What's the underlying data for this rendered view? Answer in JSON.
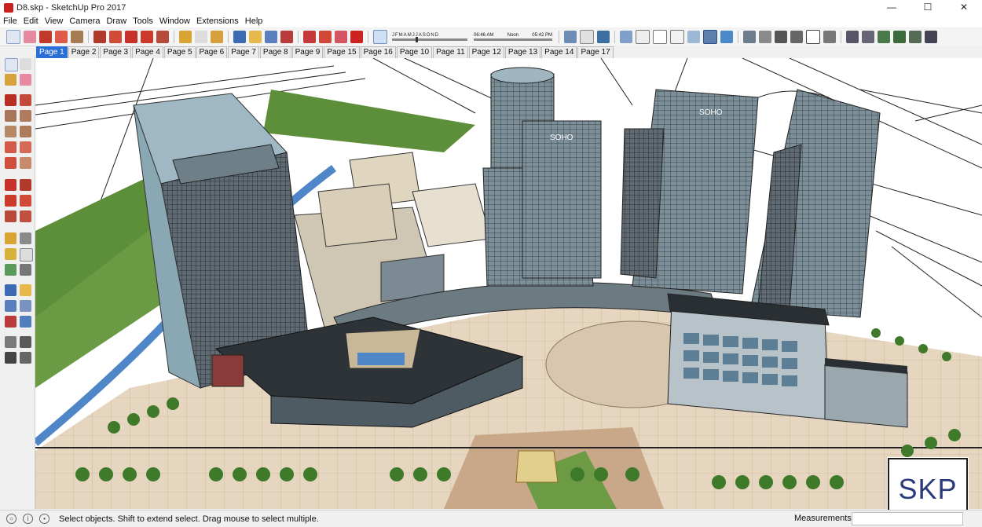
{
  "window": {
    "title": "D8.skp - SketchUp Pro 2017",
    "controls": [
      "—",
      "☐",
      "✕"
    ]
  },
  "menu": [
    "File",
    "Edit",
    "View",
    "Camera",
    "Draw",
    "Tools",
    "Window",
    "Extensions",
    "Help"
  ],
  "shadows": {
    "months": [
      "J",
      "F",
      "M",
      "A",
      "M",
      "J",
      "J",
      "A",
      "S",
      "O",
      "N",
      "D"
    ],
    "time_start": "06:46 AM",
    "time_mid": "Noon",
    "time_end": "05:42 PM"
  },
  "scenes": [
    "Page 1",
    "Page 2",
    "Page 3",
    "Page 4",
    "Page 5",
    "Page 6",
    "Page 7",
    "Page 8",
    "Page 9",
    "Page 15",
    "Page 16",
    "Page 10",
    "Page 11",
    "Page 12",
    "Page 13",
    "Page 14",
    "Page 17"
  ],
  "active_scene": "Page 1",
  "status": {
    "text": "Select objects. Shift to extend select. Drag mouse to select multiple.",
    "measurements_label": "Measurements",
    "measurements_value": ""
  },
  "watermark": "SKP",
  "model_signage": [
    "SOHO",
    "SOHO"
  ],
  "colors": {
    "accent_tab": "#2a6fd6",
    "lawn": "#5d8f3a",
    "water": "#4f86c8",
    "glass": "#8fb7c7"
  }
}
